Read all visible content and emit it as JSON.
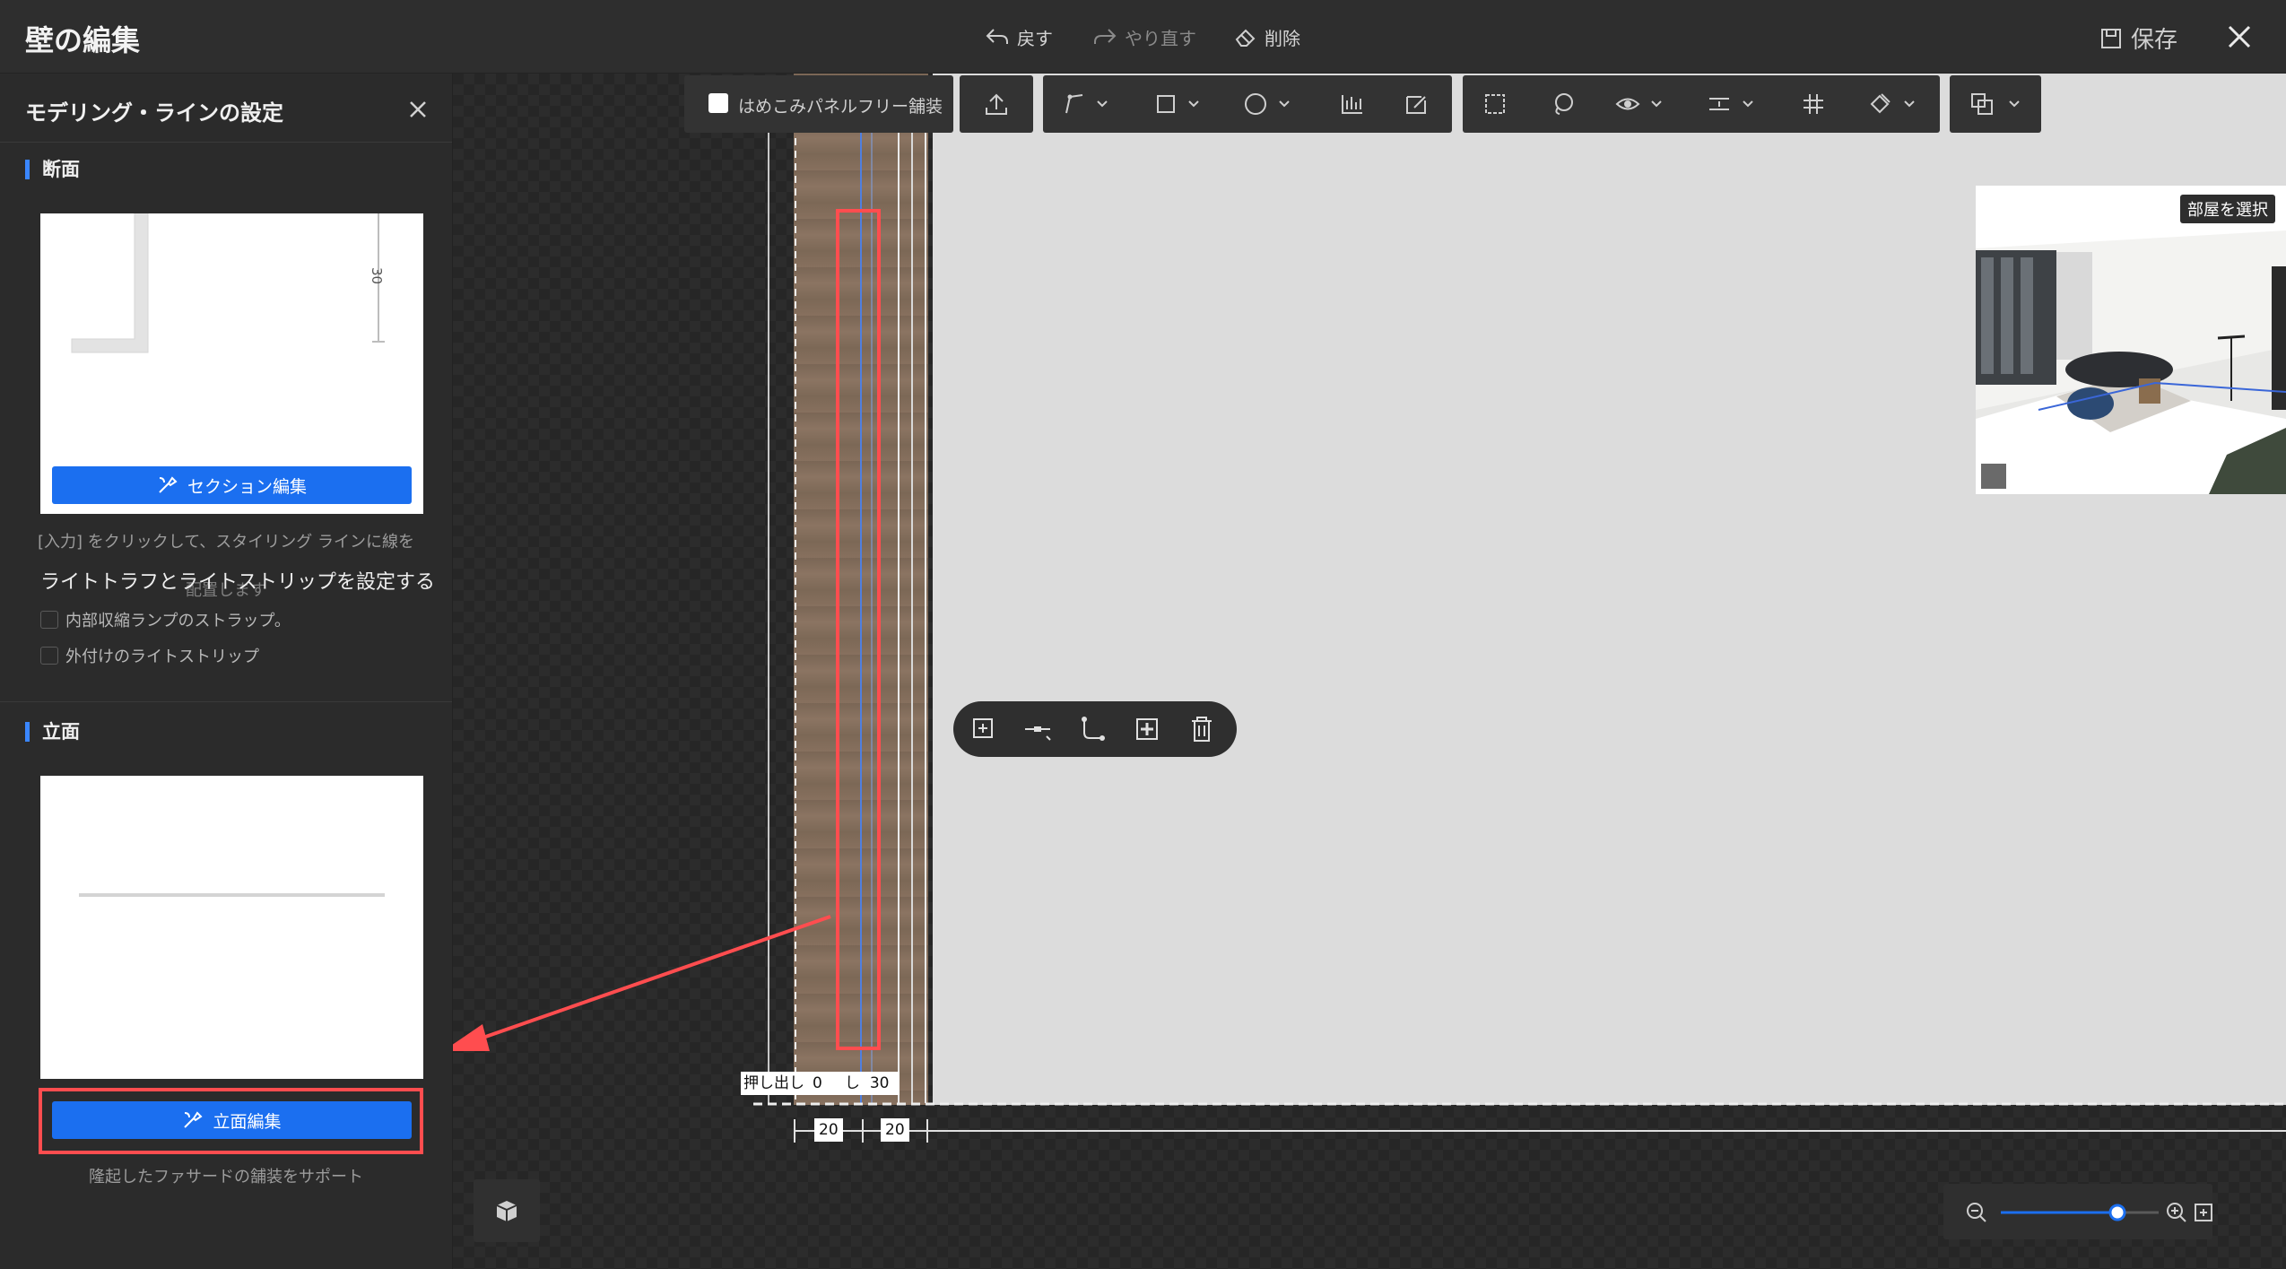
{
  "app": {
    "title": "壁の編集"
  },
  "header": {
    "undo_label": "戻す",
    "redo_label": "やり直す",
    "delete_label": "削除",
    "save_label": "保存"
  },
  "panel": {
    "title": "モデリング・ラインの設定",
    "section1": {
      "title": "断面",
      "dimension": "30",
      "button_label": "セクション編集",
      "hint": "[入力] をクリックして、スタイリング ラインに線を",
      "hint2": "配置します",
      "light_title": "ライトトラフとライトストリップを設定する",
      "option1": "内部収縮ランプのストラップ。",
      "option2": "外付けのライトストリップ"
    },
    "section2": {
      "title": "立面",
      "button_label": "立面編集",
      "description": "隆起したファサードの舗装をサポート"
    }
  },
  "toolbar": {
    "inlay_label": "はめこみパネルフリー舗装",
    "icons": [
      "upload-icon",
      "polyline-icon",
      "rectangle-icon",
      "circle-icon",
      "align-icon",
      "edit-panel-icon",
      "select-area-icon",
      "lasso-icon",
      "eye-icon",
      "distribute-icon",
      "grid-icon",
      "paint-icon",
      "copy-icon"
    ]
  },
  "preview": {
    "room_select_label": "部屋を選択"
  },
  "canvas": {
    "extrude_label": "押し出し",
    "extrude_value": "0",
    "offset_label": "し",
    "offset_value": "30",
    "dim_a": "20",
    "dim_b": "20"
  },
  "colors": {
    "accent": "#1b6ff0",
    "highlight": "#ff4d4f"
  }
}
